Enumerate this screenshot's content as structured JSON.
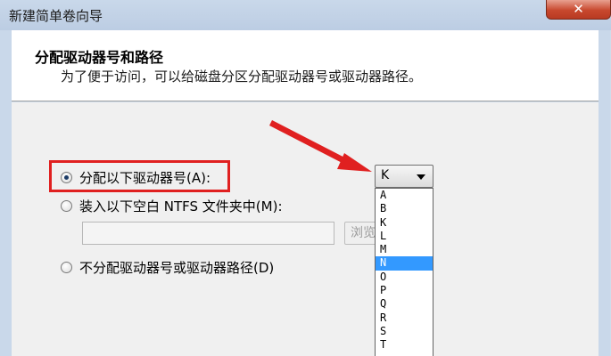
{
  "window": {
    "title": "新建简单卷向导",
    "close_label": "✕"
  },
  "header": {
    "title": "分配驱动器号和路径",
    "subtitle": "为了便于访问，可以给磁盘分区分配驱动器号或驱动器路径。"
  },
  "options": {
    "assign_letter": {
      "label": "分配以下驱动器号(A):",
      "checked": true
    },
    "mount_folder": {
      "label": "装入以下空白 NTFS 文件夹中(M):",
      "checked": false
    },
    "no_assign": {
      "label": "不分配驱动器号或驱动器路径(D)",
      "checked": false
    }
  },
  "path_field": {
    "value": ""
  },
  "browse_button": {
    "label": "浏览(R)..."
  },
  "drive_combo": {
    "selected": "K",
    "items": [
      "A",
      "B",
      "K",
      "L",
      "M",
      "N",
      "O",
      "P",
      "Q",
      "R",
      "S",
      "T"
    ],
    "highlighted": "N"
  },
  "colors": {
    "accent_red": "#e02020",
    "selection_blue": "#3399ff"
  }
}
